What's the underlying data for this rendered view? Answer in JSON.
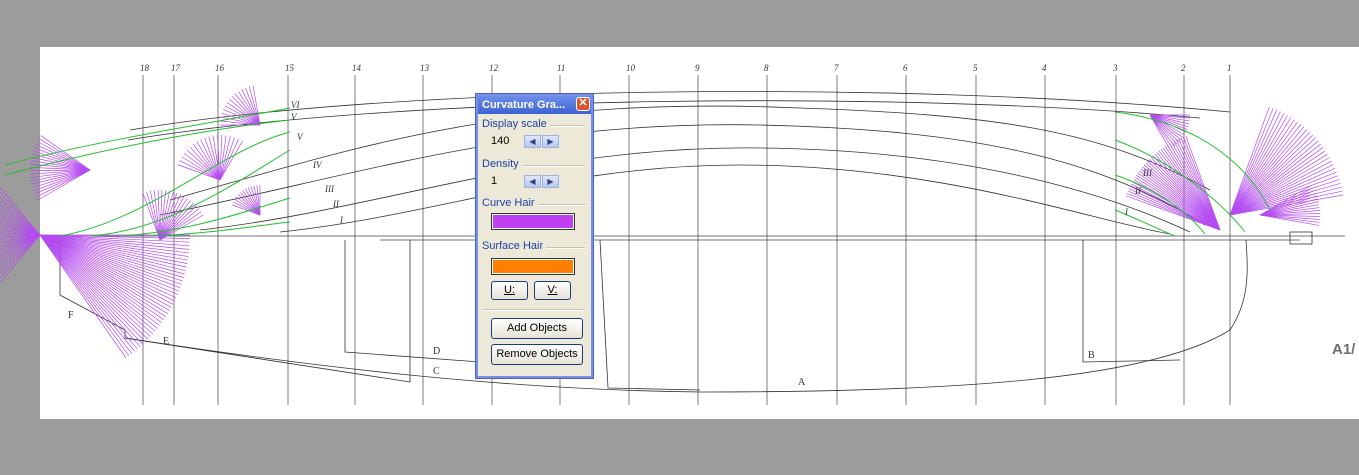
{
  "drawing": {
    "station_labels": [
      "18",
      "17",
      "16",
      "15",
      "14",
      "13",
      "12",
      "11",
      "10",
      "9",
      "8",
      "7",
      "6",
      "5",
      "4",
      "3",
      "2",
      "1"
    ],
    "waterline_labels": [
      "VI",
      "V",
      "V",
      "IV",
      "III",
      "II",
      "I",
      "III",
      "II",
      "I"
    ],
    "buttock_labels": [
      "F",
      "E",
      "D",
      "C",
      "A",
      "B"
    ],
    "sheet_tag": "A1/",
    "curve_hair_color": "#b44bf0",
    "curve_color": "#22c02a"
  },
  "panel": {
    "title": "Curvature Gra...",
    "close_icon": "close-icon",
    "display_scale": {
      "label": "Display scale",
      "value": "140",
      "dec_icon": "◀",
      "inc_icon": "▶"
    },
    "density": {
      "label": "Density",
      "value": "1",
      "dec_icon": "◀",
      "inc_icon": "▶"
    },
    "curve_hair": {
      "label": "Curve Hair",
      "color": "#bf40f2"
    },
    "surface_hair": {
      "label": "Surface Hair",
      "color": "#ff8000"
    },
    "u_button": "U:",
    "v_button": "V:",
    "add_objects": "Add Objects",
    "remove_objects": "Remove Objects"
  }
}
